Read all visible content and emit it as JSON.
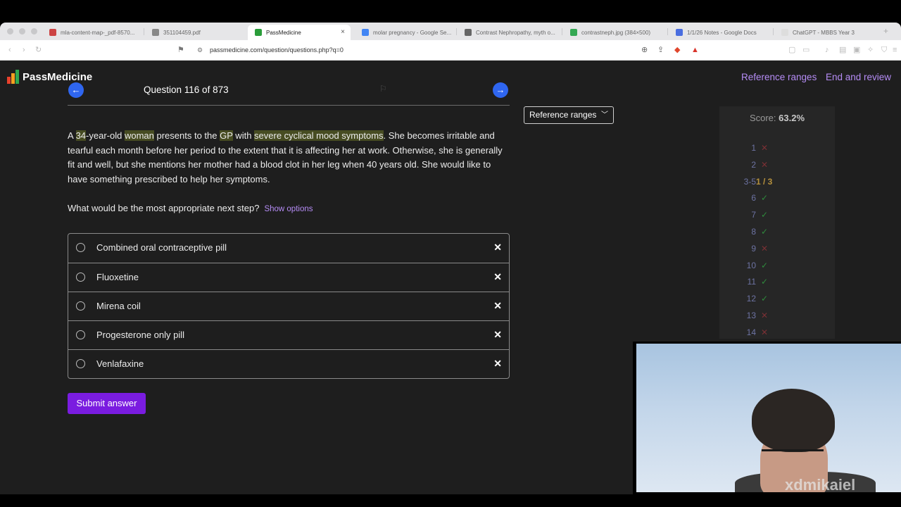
{
  "browser": {
    "tabs": [
      {
        "label": "mla-content-map-_pdf-8570...",
        "fav": "#c44",
        "icon": "globe-icon"
      },
      {
        "label": "351104459.pdf",
        "fav": "#888",
        "icon": "globe-icon"
      },
      {
        "label": "PassMedicine",
        "fav": "#2a9d3a",
        "icon": "passmedicine-icon"
      },
      {
        "label": "molar pregnancy - Google Se...",
        "fav": "#4285f4",
        "icon": "google-icon"
      },
      {
        "label": "Contrast Nephropathy, myth o...",
        "fav": "#666",
        "icon": "article-icon"
      },
      {
        "label": "contrastneph.jpg (384×500)",
        "fav": "#34a853",
        "icon": "image-icon"
      },
      {
        "label": "1/1/26 Notes - Google Docs",
        "fav": "#4a6ee0",
        "icon": "docs-icon"
      },
      {
        "label": "ChatGPT - MBBS Year 3",
        "fav": "#ddd",
        "icon": "chatgpt-icon"
      }
    ],
    "url": "passmedicine.com/question/questions.php?q=0"
  },
  "header": {
    "logo": "PassMedicine",
    "logo_colors": [
      "#e8412c",
      "#f4a020",
      "#2fa84f"
    ],
    "links": [
      "Reference ranges",
      "End and review"
    ],
    "link_color": "#b58cf5"
  },
  "question": {
    "counter": "Question 116 of 873",
    "stem_parts": [
      {
        "t": "A ",
        "h": false
      },
      {
        "t": "34",
        "h": true
      },
      {
        "t": "-year-old ",
        "h": false
      },
      {
        "t": "woman",
        "h": true
      },
      {
        "t": " presents to the ",
        "h": false
      },
      {
        "t": "GP",
        "h": true
      },
      {
        "t": " with ",
        "h": false
      },
      {
        "t": "severe cyclical mood symptoms",
        "h": true
      },
      {
        "t": ". She becomes irritable and tearful each month before her period to the extent that it is affecting her at work. Otherwise, she is generally fit and well, but she mentions her mother had a blood clot in her leg when 40 years old. She would like to have something prescribed to help her symptoms.",
        "h": false
      }
    ],
    "prompt": "What would be the most appropriate next step?",
    "show_options": "Show options",
    "options": [
      "Combined oral contraceptive pill",
      "Fluoxetine",
      "Mirena coil",
      "Progesterone only pill",
      "Venlafaxine"
    ],
    "submit": "Submit answer"
  },
  "reference_dropdown": "Reference ranges",
  "score": {
    "label": "Score:",
    "value": "63.2%",
    "rows": [
      {
        "n": "1",
        "r": "wrong"
      },
      {
        "n": "2",
        "r": "wrong"
      },
      {
        "n": "3-5",
        "r": "partial",
        "text": "1 / 3"
      },
      {
        "n": "6",
        "r": "right"
      },
      {
        "n": "7",
        "r": "right"
      },
      {
        "n": "8",
        "r": "right"
      },
      {
        "n": "9",
        "r": "wrong"
      },
      {
        "n": "10",
        "r": "right"
      },
      {
        "n": "11",
        "r": "right"
      },
      {
        "n": "12",
        "r": "right"
      },
      {
        "n": "13",
        "r": "wrong"
      },
      {
        "n": "14",
        "r": "wrong"
      }
    ]
  },
  "watermark": "xdmikaiel"
}
